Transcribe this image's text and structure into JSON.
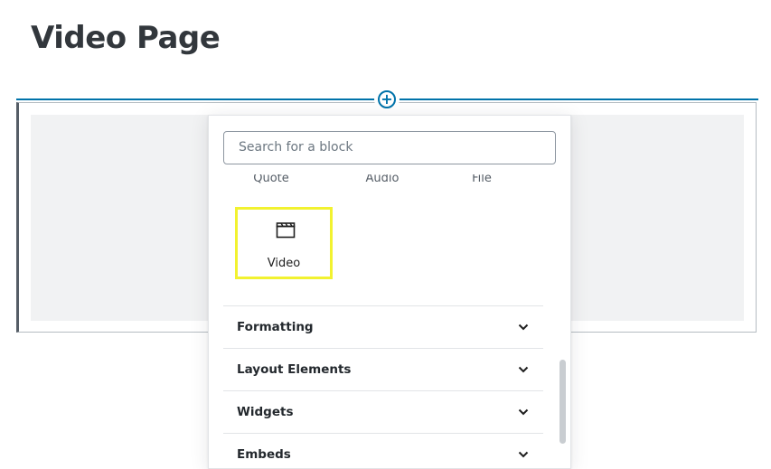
{
  "page": {
    "title": "Video Page"
  },
  "inserter": {
    "search_placeholder": "Search for a block",
    "partial_blocks": [
      "Quote",
      "Audio",
      "File"
    ],
    "highlighted_block": {
      "label": "Video",
      "icon": "video-clapper-icon"
    },
    "categories": [
      {
        "label": "Formatting",
        "icon": "chevron-down-icon"
      },
      {
        "label": "Layout Elements",
        "icon": "chevron-down-icon"
      },
      {
        "label": "Widgets",
        "icon": "chevron-down-icon"
      },
      {
        "label": "Embeds",
        "icon": "chevron-down-icon"
      }
    ]
  },
  "colors": {
    "accent": "#0073aa",
    "highlight": "#f2f230",
    "title": "#32373c",
    "placeholder_bg": "#f1f2f3"
  }
}
